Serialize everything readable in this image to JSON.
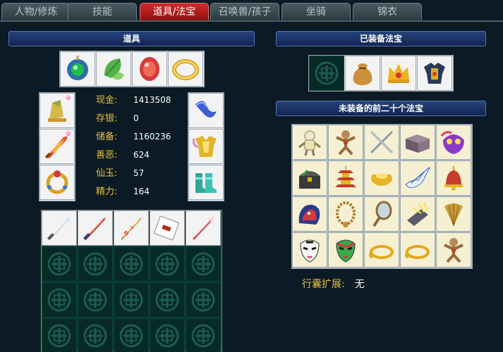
{
  "tabs": [
    {
      "label": "人物/修炼",
      "active": false
    },
    {
      "label": "技能",
      "active": false
    },
    {
      "label": "道具/法宝",
      "active": true
    },
    {
      "label": "召唤兽/孩子",
      "active": false
    },
    {
      "label": "坐骑",
      "active": false
    },
    {
      "label": "锦衣",
      "active": false
    }
  ],
  "items_panel": {
    "title": "道具",
    "top_equipment": [
      "jade-pendant-icon",
      "leaf-charm-icon",
      "red-gem-icon",
      "gold-bracelet-icon"
    ],
    "left_equipment": [
      "gold-hat-icon",
      "flame-sword-icon",
      "gold-ring-icon"
    ],
    "right_equipment": [
      "blue-ribbon-icon",
      "gold-armor-icon",
      "teal-boots-icon"
    ],
    "stats": [
      {
        "label": "现金:",
        "value": "1413508"
      },
      {
        "label": "存银:",
        "value": "0"
      },
      {
        "label": "储备:",
        "value": "1160236"
      },
      {
        "label": "善恶:",
        "value": "624"
      },
      {
        "label": "仙玉:",
        "value": "57"
      },
      {
        "label": "精力:",
        "value": "164"
      }
    ],
    "bag_items": [
      "silver-sword-icon",
      "red-blade-icon",
      "ornate-dagger-icon",
      "scroll-note-icon",
      "red-spear-icon"
    ],
    "empty_slot_icon": "spiral-emblem-icon"
  },
  "equipped_panel": {
    "title": "已装备法宝",
    "items": [
      "spiral-emblem-icon",
      "money-bag-icon",
      "gold-crown-icon",
      "dark-armor-icon"
    ]
  },
  "unequipped_panel": {
    "title": "未装备的前二十个法宝",
    "items": [
      "voodoo-doll-icon",
      "wooden-figure-icon",
      "crossed-swords-icon",
      "stone-box-icon",
      "purple-mask-icon",
      "treasure-chest-icon",
      "pagoda-icon",
      "gold-ingot-icon",
      "white-bird-icon",
      "red-bell-icon",
      "red-lion-icon",
      "bead-necklace-icon",
      "hand-mirror-icon",
      "glowing-slab-icon",
      "feather-fan-icon",
      "opera-mask-white-icon",
      "opera-mask-green-icon",
      "gold-rope-icon",
      "gold-rope-icon",
      "wooden-figure-icon"
    ]
  },
  "bag_expand": {
    "label": "行囊扩展:",
    "value": "无"
  },
  "colors": {
    "active_tab": "#c41e1e",
    "header": "#1b3266",
    "stat_label": "#e8c040",
    "background": "#0b1a24"
  }
}
